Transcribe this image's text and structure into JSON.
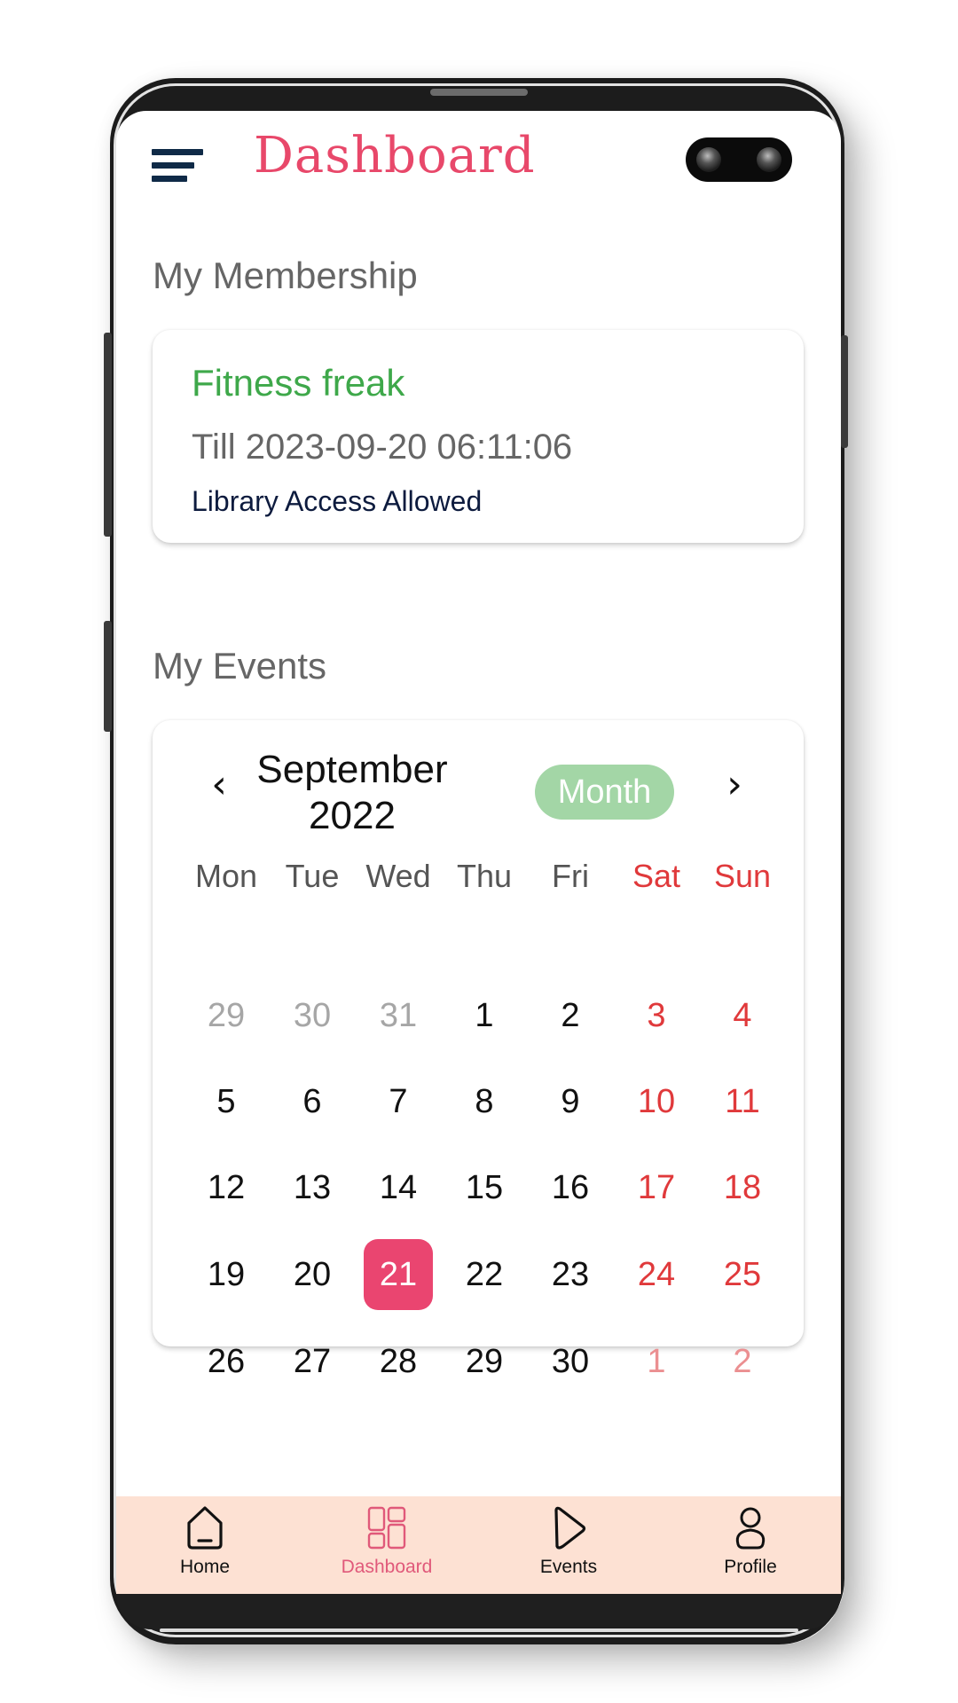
{
  "header": {
    "title": "Dashboard",
    "menu_icon": "hamburger-menu-icon"
  },
  "membership": {
    "section_title": "My Membership",
    "plan_name": "Fitness freak",
    "valid_till": "Till 2023-09-20 06:11:06",
    "access": "Library Access Allowed"
  },
  "events": {
    "section_title": "My Events",
    "calendar": {
      "prev_icon": "chevron-left-icon",
      "next_icon": "chevron-right-icon",
      "month": "September",
      "year": "2022",
      "view_button": "Month",
      "weekdays": [
        "Mon",
        "Tue",
        "Wed",
        "Thu",
        "Fri",
        "Sat",
        "Sun"
      ],
      "weeks": [
        [
          {
            "d": "29",
            "muted": true
          },
          {
            "d": "30",
            "muted": true
          },
          {
            "d": "31",
            "muted": true
          },
          {
            "d": "1"
          },
          {
            "d": "2"
          },
          {
            "d": "3"
          },
          {
            "d": "4"
          }
        ],
        [
          {
            "d": "5"
          },
          {
            "d": "6"
          },
          {
            "d": "7"
          },
          {
            "d": "8"
          },
          {
            "d": "9"
          },
          {
            "d": "10"
          },
          {
            "d": "11"
          }
        ],
        [
          {
            "d": "12"
          },
          {
            "d": "13"
          },
          {
            "d": "14"
          },
          {
            "d": "15"
          },
          {
            "d": "16"
          },
          {
            "d": "17"
          },
          {
            "d": "18"
          }
        ],
        [
          {
            "d": "19"
          },
          {
            "d": "20"
          },
          {
            "d": "21",
            "selected": true
          },
          {
            "d": "22"
          },
          {
            "d": "23"
          },
          {
            "d": "24"
          },
          {
            "d": "25"
          }
        ],
        [
          {
            "d": "26"
          },
          {
            "d": "27"
          },
          {
            "d": "28"
          },
          {
            "d": "29"
          },
          {
            "d": "30"
          },
          {
            "d": "1",
            "muted": true
          },
          {
            "d": "2",
            "muted": true
          }
        ]
      ],
      "selected_date": "21"
    }
  },
  "bottom_nav": {
    "items": [
      {
        "label": "Home",
        "icon": "home-icon",
        "active": false
      },
      {
        "label": "Dashboard",
        "icon": "dashboard-icon",
        "active": true
      },
      {
        "label": "Events",
        "icon": "play-icon",
        "active": false
      },
      {
        "label": "Profile",
        "icon": "profile-icon",
        "active": false
      }
    ]
  },
  "colors": {
    "accent": "#e8486a",
    "selected_day": "#ea4570",
    "plan_green": "#3ea84a",
    "month_pill": "#a3d6a6",
    "weekend_red": "#e0393b",
    "nav_bg": "#fde1d3"
  }
}
